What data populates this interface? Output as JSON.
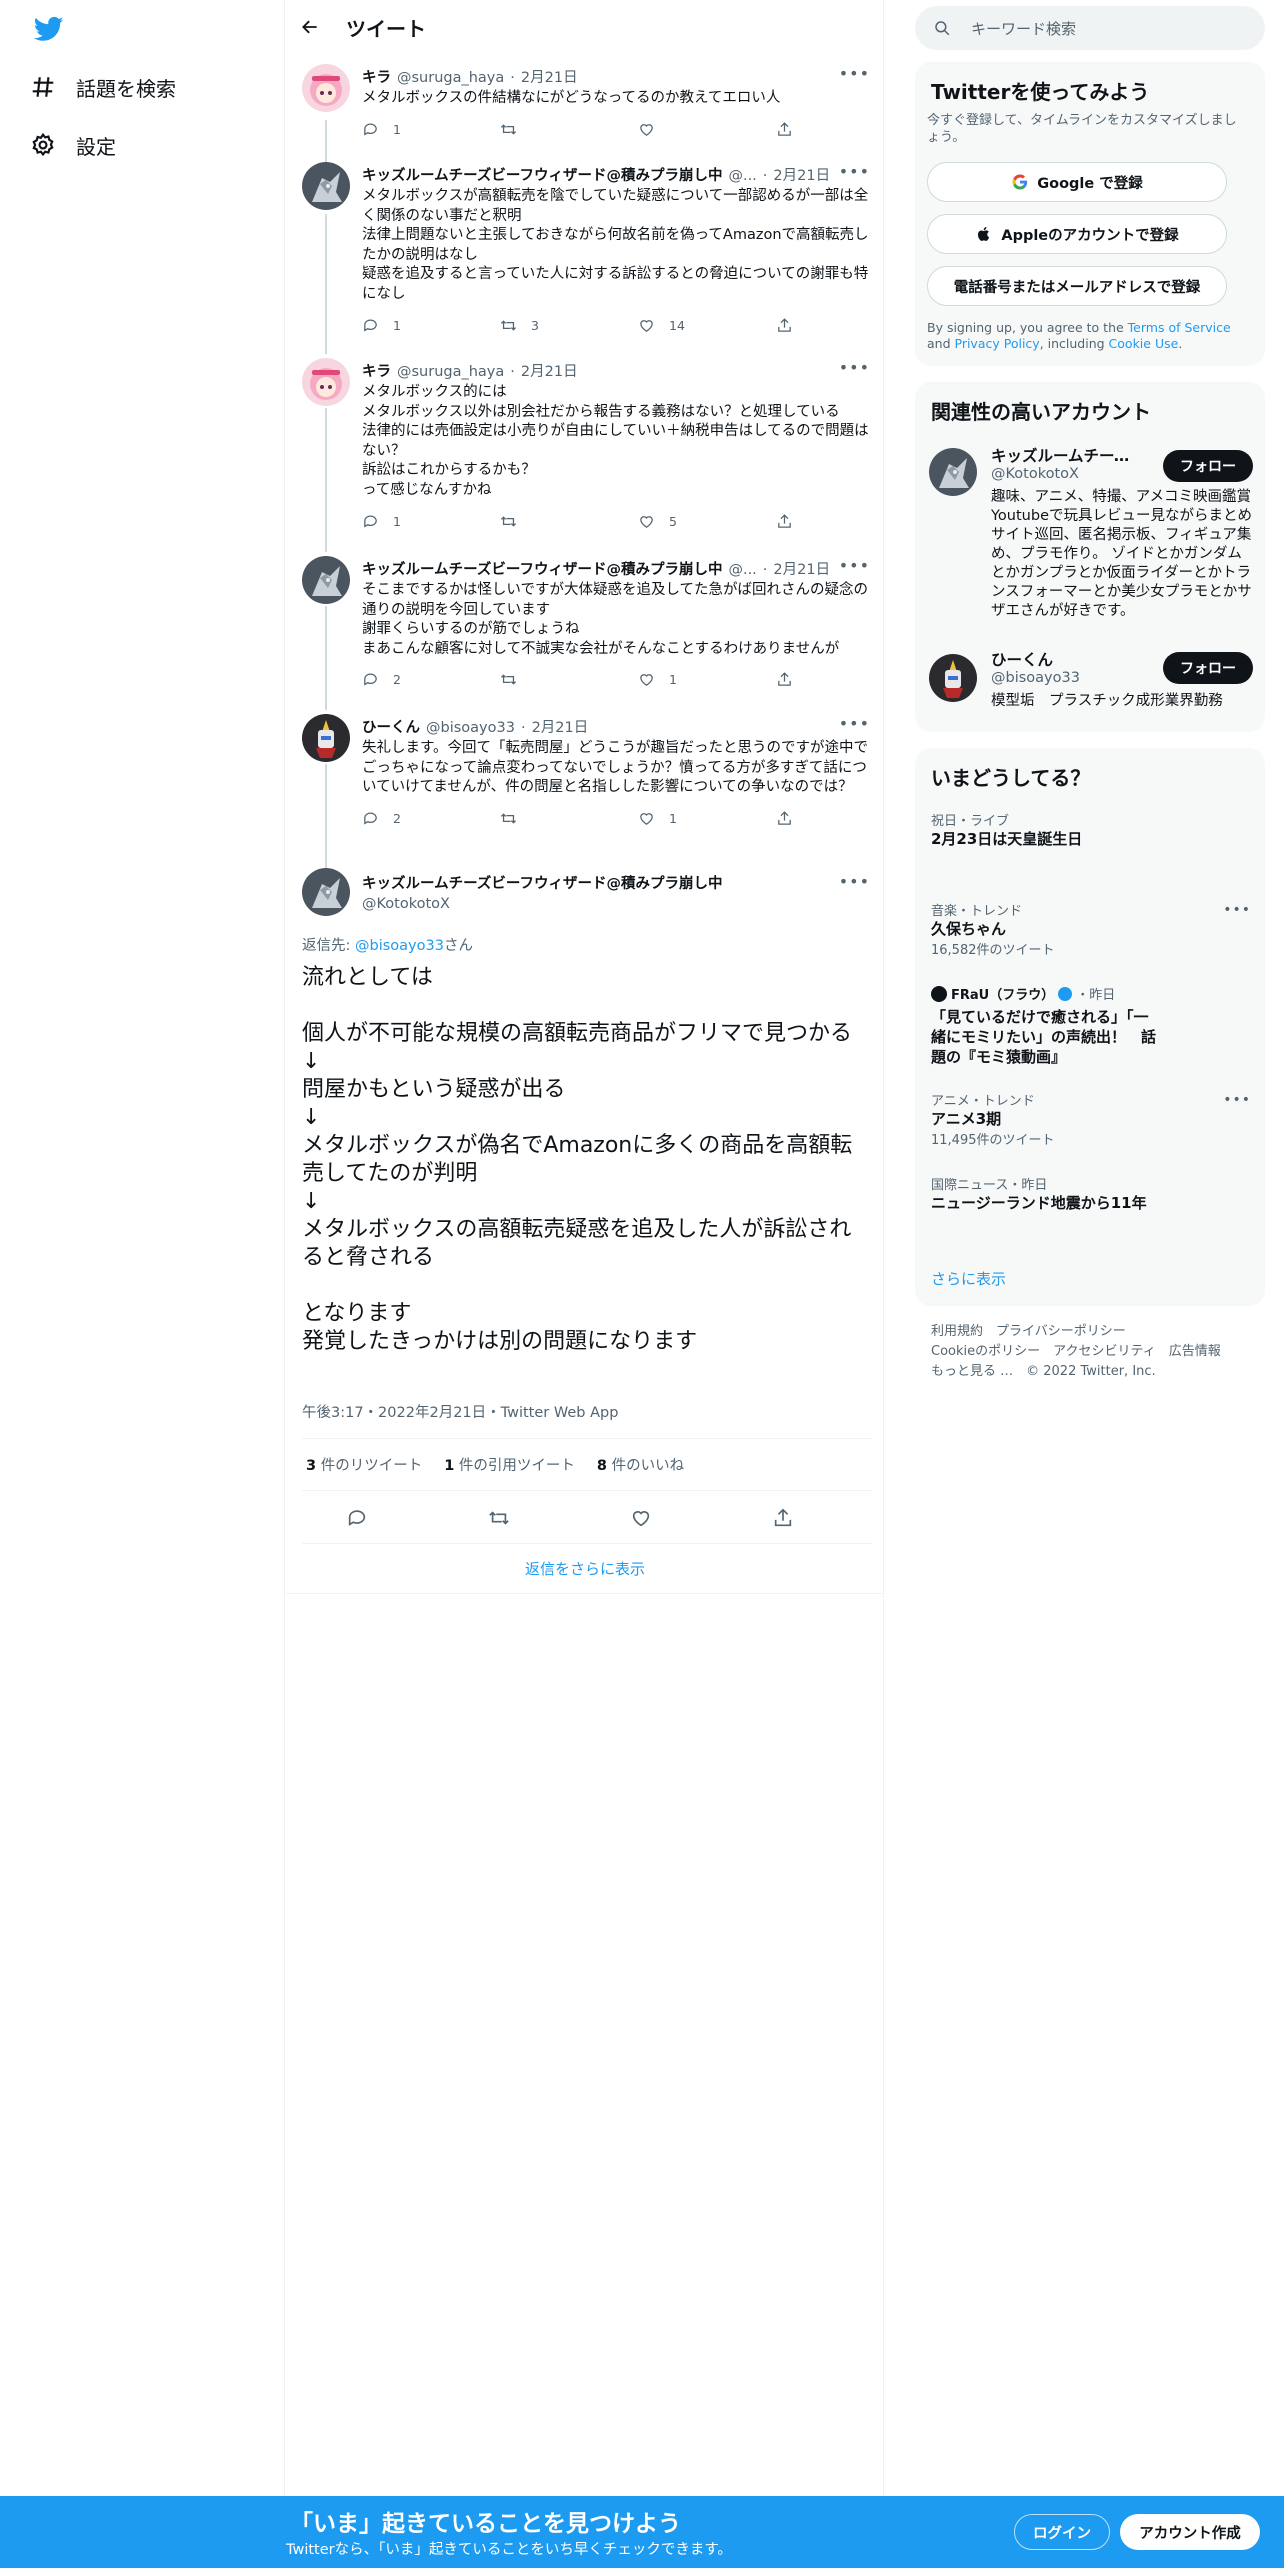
{
  "nav": {
    "explore": "話題を検索",
    "settings": "設定"
  },
  "header": {
    "title": "ツイート"
  },
  "thread": [
    {
      "name": "キラ",
      "handle": "@suruga_haya",
      "date": "2月21日",
      "text": "メタルボックスの件結構なにがどうなってるのか教えてエロい人",
      "replies": "1",
      "retweets": "",
      "likes": "",
      "avatar": "pink"
    },
    {
      "name": "キッズルームチーズビーフウィザード@積みプラ崩し中",
      "handle": "@...",
      "date": "2月21日",
      "text": "メタルボックスが高額転売を陰でしていた疑惑について一部認めるが一部は全く関係のない事だと釈明\n法律上問題ないと主張しておきながら何故名前を偽ってAmazonで高額転売したかの説明はなし\n疑惑を追及すると言っていた人に対する訴訟するとの脅迫についての謝罪も特になし",
      "replies": "1",
      "retweets": "3",
      "likes": "14",
      "avatar": "robot"
    },
    {
      "name": "キラ",
      "handle": "@suruga_haya",
      "date": "2月21日",
      "text": "メタルボックス的には\nメタルボックス以外は別会社だから報告する義務はない？と処理している\n法律的には売価設定は小売りが自由にしていい＋納税申告はしてるので問題はない？\n訴訟はこれからするかも？\nって感じなんすかね",
      "replies": "1",
      "retweets": "",
      "likes": "5",
      "avatar": "pink"
    },
    {
      "name": "キッズルームチーズビーフウィザード@積みプラ崩し中",
      "handle": "@...",
      "date": "2月21日",
      "text": "そこまでするかは怪しいですが大体疑惑を追及してた急がば回れさんの疑念の通りの説明を今回しています\n謝罪くらいするのが筋でしょうね\nまあこんな顧客に対して不誠実な会社がそんなことするわけありませんが",
      "replies": "2",
      "retweets": "",
      "likes": "1",
      "avatar": "robot"
    },
    {
      "name": "ひーくん",
      "handle": "@bisoayo33",
      "date": "2月21日",
      "text": "失礼します。今回て「転売問屋」どうこうが趣旨だったと思うのですが途中でごっちゃになって論点変わってないでしょうか？憤ってる方が多すぎて話についていけてませんが、件の問屋と名指しした影響についての争いなのでは？",
      "replies": "2",
      "retweets": "",
      "likes": "1",
      "avatar": "gundam"
    }
  ],
  "main_tweet": {
    "name": "キッズルームチーズビーフウィザード@積みプラ崩し中",
    "handle": "@KotokotoX",
    "reply_prefix": "返信先: ",
    "reply_to": "@bisoayo33",
    "reply_suffix": "さん",
    "text": "流れとしては\n\n個人が不可能な規模の高額転売商品がフリマで見つかる\n↓\n問屋かもという疑惑が出る\n↓\nメタルボックスが偽名でAmazonに多くの商品を高額転売してたのが判明\n↓\nメタルボックスの高額転売疑惑を追及した人が訴訟されると脅される\n\nとなります\n発覚したきっかけは別の問題になります",
    "timestamp": "午後3:17・2022年2月21日・Twitter Web App",
    "retweets_count": "3",
    "retweets_label": " 件のリツイート",
    "quotes_count": "1",
    "quotes_label": " 件の引用ツイート",
    "likes_count": "8",
    "likes_label": " 件のいいね",
    "more_replies": "返信をさらに表示"
  },
  "search": {
    "placeholder": "キーワード検索"
  },
  "signup": {
    "title": "Twitterを使ってみよう",
    "desc": "今すぐ登録して、タイムラインをカスタマイズしましょう。",
    "google": "Google で登録",
    "apple": "Appleのアカウントで登録",
    "phone": "電話番号またはメールアドレスで登録",
    "terms_1": "By signing up, you agree to the ",
    "terms_tos": "Terms of Service",
    "terms_2": " and ",
    "terms_pp": "Privacy Policy",
    "terms_3": ", including ",
    "terms_cookie": "Cookie Use",
    "terms_4": "."
  },
  "relevant": {
    "title": "関連性の高いアカウント",
    "accounts": [
      {
        "name": "キッズルームチーズ…",
        "handle": "@KotokotoX",
        "bio": "趣味、アニメ、特撮、アメコミ映画鑑賞 Youtubeで玩具レビュー見ながらまとめサイト巡回、匿名掲示板、フィギュア集め、プラモ作り。 ゾイドとかガンダムとかガンプラとか仮面ライダーとかトランスフォーマーとか美少女プラモとかサザエさんが好きです。",
        "follow": "フォロー"
      },
      {
        "name": "ひーくん",
        "handle": "@bisoayo33",
        "bio": "模型垢　プラスチック成形業界勤務",
        "follow": "フォロー"
      }
    ]
  },
  "trends": {
    "title": "いまどうしてる？",
    "items": [
      {
        "category": "祝日・ライブ",
        "title": "2月23日は天皇誕生日",
        "count": ""
      },
      {
        "category": "音楽・トレンド",
        "title": "久保ちゃん",
        "count": "16,582件のツイート"
      },
      {
        "category": "FRaU（フラウ）",
        "category_time": "・昨日",
        "title": "「見ているだけで癒される」「一緒にモミリたい」の声続出！　話題の『モミ猿動画』",
        "count": ""
      },
      {
        "category": "アニメ・トレンド",
        "title": "アニメ3期",
        "count": "11,495件のツイート"
      },
      {
        "category": "国際ニュース・昨日",
        "title": "ニュージーランド地震から11年",
        "count": ""
      }
    ],
    "show_more": "さらに表示"
  },
  "footer": {
    "line1": "利用規約　プライバシーポリシー",
    "line2": "Cookieのポリシー　アクセシビリティ　広告情報",
    "line3": "もっと見る …　© 2022 Twitter, Inc."
  },
  "bottom_bar": {
    "title": "「いま」起きていることを見つけよう",
    "sub": "Twitterなら、「いま」起きていることをいち早くチェックできます。",
    "login": "ログイン",
    "signup": "アカウント作成"
  },
  "colors": {
    "accent": "#1d9bf0",
    "text": "#0f1419",
    "muted": "#536471"
  }
}
